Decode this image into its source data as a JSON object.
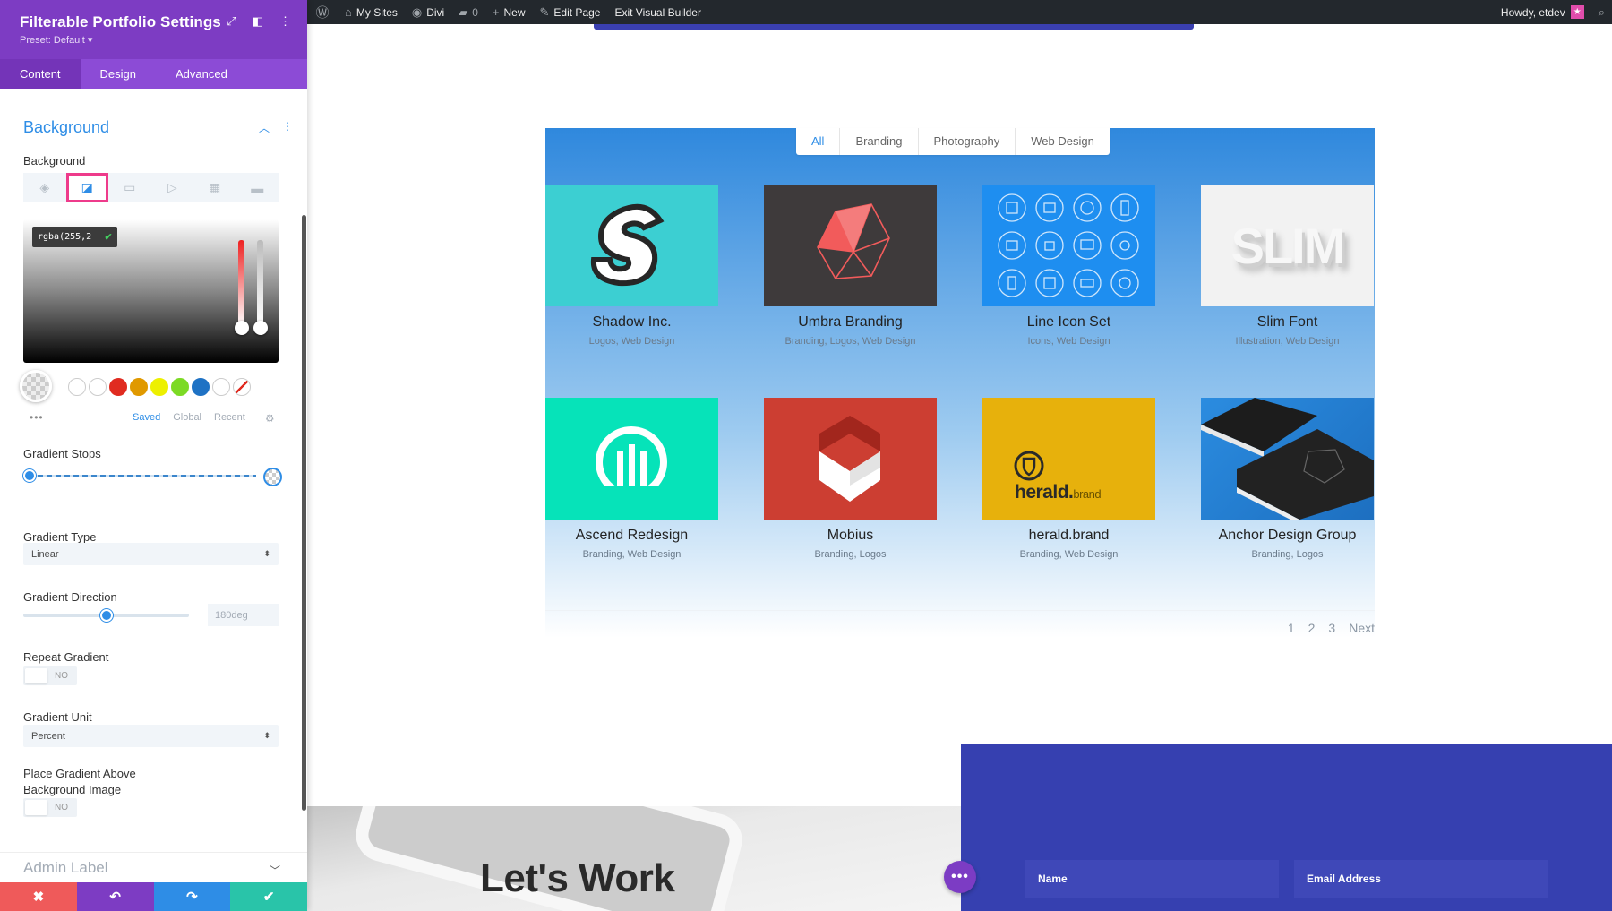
{
  "admin_bar": {
    "my_sites": "My Sites",
    "divi": "Divi",
    "comments": "0",
    "new": "New",
    "edit_page": "Edit Page",
    "exit_builder": "Exit Visual Builder",
    "howdy": "Howdy, etdev"
  },
  "panel": {
    "title": "Filterable Portfolio Settings",
    "preset": "Preset: Default ▾",
    "tabs": [
      "Content",
      "Design",
      "Advanced"
    ],
    "active_tab": "Content",
    "section_title": "Background",
    "background_label": "Background",
    "color_value": "rgba(255,2",
    "swatch_colors": [
      "#ffffff",
      "#ffffff",
      "#e02b20",
      "#e09900",
      "#edf000",
      "#7cda24",
      "#1f72c4",
      "#ffffff"
    ],
    "swatch_tabs": [
      "Saved",
      "Global",
      "Recent"
    ],
    "gradient_stops_label": "Gradient Stops",
    "gradient_type_label": "Gradient Type",
    "gradient_type_value": "Linear",
    "gradient_direction_label": "Gradient Direction",
    "gradient_direction_value": "180deg",
    "gradient_direction_fraction": 0.5,
    "repeat_gradient_label": "Repeat Gradient",
    "repeat_gradient_value": "NO",
    "gradient_unit_label": "Gradient Unit",
    "gradient_unit_value": "Percent",
    "place_above_label_1": "Place Gradient Above",
    "place_above_label_2": "Background Image",
    "place_above_value": "NO",
    "admin_label": "Admin Label",
    "colors": {
      "accent": "#2e8de6",
      "header": "#7d3cc3",
      "highlight": "#ee3b8b",
      "cancel": "#ef5a5a",
      "undo": "#7d3cc3",
      "redo": "#2e8de6",
      "save": "#29c4a9"
    }
  },
  "portfolio": {
    "filters": [
      "All",
      "Branding",
      "Photography",
      "Web Design"
    ],
    "active_filter": "All",
    "items": [
      {
        "name": "Shadow Inc.",
        "cats": "Logos, Web Design",
        "color": "#3ccfd2"
      },
      {
        "name": "Umbra Branding",
        "cats": "Branding, Logos, Web Design",
        "color": "#3e3a3b"
      },
      {
        "name": "Line Icon Set",
        "cats": "Icons, Web Design",
        "color": "#1e8ef0"
      },
      {
        "name": "Slim Font",
        "cats": "Illustration, Web Design",
        "color": "#f2f2f2"
      },
      {
        "name": "Ascend Redesign",
        "cats": "Branding, Web Design",
        "color": "#06e3b9"
      },
      {
        "name": "Mobius",
        "cats": "Branding, Logos",
        "color": "#cc3e32"
      },
      {
        "name": "herald.brand",
        "cats": "Branding, Web Design",
        "color": "#e7b10c"
      },
      {
        "name": "Anchor Design Group",
        "cats": "Branding, Logos",
        "color": "#2a2f36"
      }
    ],
    "slim_text": "SLIM",
    "herald_main": "herald.",
    "herald_sub": "brand",
    "pagination": [
      "1",
      "2",
      "3",
      "Next"
    ]
  },
  "footer_section": {
    "lets_work": "Let's Work",
    "name_placeholder": "Name",
    "email_placeholder": "Email Address"
  }
}
